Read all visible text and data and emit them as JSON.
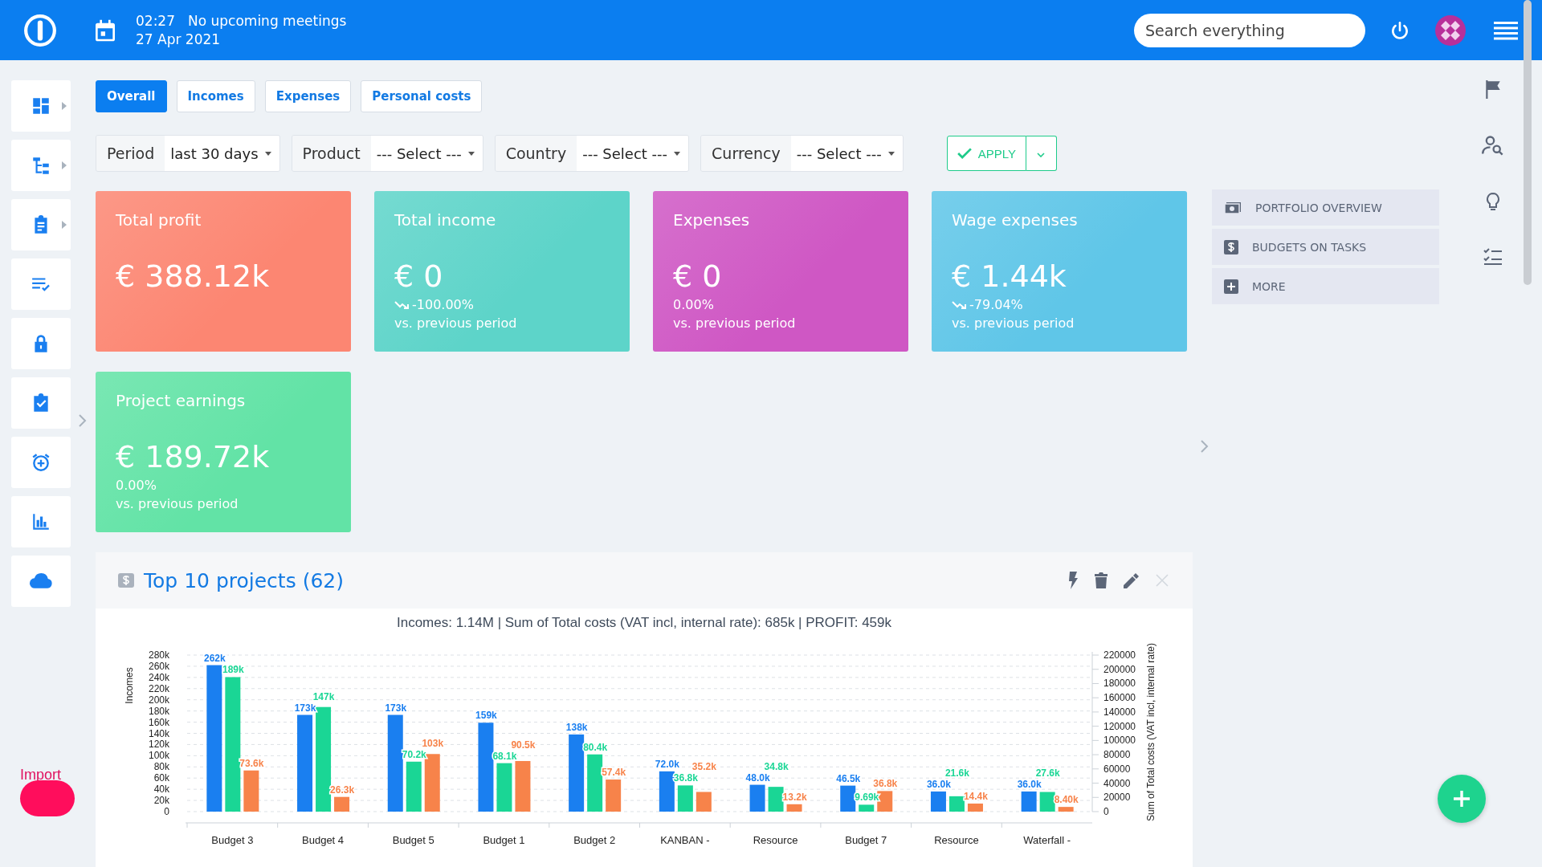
{
  "header": {
    "time": "02:27",
    "meetings": "No upcoming meetings",
    "date": "27 Apr 2021",
    "search": {
      "placeholder": "Search everything"
    }
  },
  "sidebar_items": [
    {
      "has_submenu": true
    },
    {
      "has_submenu": true
    },
    {
      "has_submenu": true
    },
    {
      "has_submenu": false
    },
    {
      "has_submenu": false
    },
    {
      "has_submenu": false
    },
    {
      "has_submenu": false
    },
    {
      "has_submenu": false
    },
    {
      "has_submenu": false
    }
  ],
  "import_label": "Import",
  "tabs": [
    {
      "label": "Overall",
      "selected": true
    },
    {
      "label": "Incomes",
      "selected": false
    },
    {
      "label": "Expenses",
      "selected": false
    },
    {
      "label": "Personal costs",
      "selected": false
    }
  ],
  "filters": [
    {
      "label": "Period",
      "value": "last 30 days"
    },
    {
      "label": "Product",
      "value": "--- Select ---"
    },
    {
      "label": "Country",
      "value": "--- Select ---"
    },
    {
      "label": "Currency",
      "value": "--- Select ---"
    }
  ],
  "apply_button": "APPLY",
  "cards": [
    {
      "title": "Total profit",
      "value": "€ 388.12k",
      "color": "#fc8672"
    },
    {
      "title": "Total income",
      "value": "€ 0",
      "change": "-100.00%",
      "falling": true,
      "note": "vs. previous period",
      "color": "#5dd4c9"
    },
    {
      "title": "Expenses",
      "value": "€ 0",
      "change": "0.00%",
      "falling": false,
      "note": "vs. previous period",
      "color": "#cf57c4"
    },
    {
      "title": "Wage expenses",
      "value": "€ 1.44k",
      "change": "-79.04%",
      "falling": true,
      "note": "vs. previous period",
      "color": "#5fc6e8"
    },
    {
      "title": "Project earnings",
      "value": "€ 189.72k",
      "change": "0.00%",
      "falling": false,
      "note": "vs. previous period",
      "color": "#62e3a6"
    }
  ],
  "quick_links": [
    {
      "label": "PORTFOLIO OVERVIEW",
      "kind": "money"
    },
    {
      "label": "BUDGETS ON TASKS",
      "kind": "dollar"
    },
    {
      "label": "MORE",
      "kind": "plus"
    }
  ],
  "panel": {
    "title": "Top 10 projects (62)",
    "summary": "Incomes: 1.14M | Sum of Total costs (VAT incl, internal rate): 685k | PROFIT: 459k",
    "chart_data": {
      "type": "bar",
      "stacked": false,
      "grid": true,
      "ylabel": "Incomes",
      "y2label": "Sum of Total costs (VAT incl, internal rate)",
      "categories": [
        "Budget 3",
        "Budget 4",
        "Budget 5",
        "Budget 1",
        "Budget 2",
        "KANBAN -",
        "Resource",
        "Budget 7",
        "Resource",
        "Waterfall -"
      ],
      "ylim": [
        0,
        280000
      ],
      "y2lim": [
        0,
        220000
      ],
      "yticks": [
        {
          "value": 0,
          "label": "0"
        },
        {
          "value": 20000,
          "label": "20k"
        },
        {
          "value": 40000,
          "label": "40k"
        },
        {
          "value": 60000,
          "label": "60k"
        },
        {
          "value": 80000,
          "label": "80k"
        },
        {
          "value": 100000,
          "label": "100k"
        },
        {
          "value": 120000,
          "label": "120k"
        },
        {
          "value": 140000,
          "label": "140k"
        },
        {
          "value": 160000,
          "label": "160k"
        },
        {
          "value": 180000,
          "label": "180k"
        },
        {
          "value": 200000,
          "label": "200k"
        },
        {
          "value": 220000,
          "label": "220k"
        },
        {
          "value": 240000,
          "label": "240k"
        },
        {
          "value": 260000,
          "label": "260k"
        },
        {
          "value": 280000,
          "label": "280k"
        }
      ],
      "y2ticks": [
        0,
        20000,
        40000,
        60000,
        80000,
        100000,
        120000,
        140000,
        160000,
        180000,
        200000,
        220000
      ],
      "series": [
        {
          "color": "#1a7ff0",
          "values": [
            262000,
            173000,
            173000,
            159000,
            138000,
            72000,
            48000,
            46500,
            36000,
            36000
          ],
          "value_labels": [
            "262k",
            "173k",
            "173k",
            "159k",
            "138k",
            "72.0k",
            "48.0k",
            "46.5k",
            "36.0k",
            "36.0k"
          ]
        },
        {
          "color": "#1ad695",
          "axis": "y2",
          "values": [
            189000,
            147000,
            70200,
            68100,
            80400,
            36800,
            34800,
            9690,
            21600,
            27600
          ],
          "value_labels": [
            "189k",
            "147k",
            "70.2k",
            "68.1k",
            "80.4k",
            "36.8k",
            "34.8k",
            "9.69k",
            "21.6k",
            "27.6k"
          ]
        },
        {
          "color": "#f7834a",
          "values": [
            73600,
            26300,
            103000,
            90500,
            57400,
            35200,
            13200,
            36800,
            14400,
            8400
          ],
          "value_labels": [
            "73.6k",
            "26.3k",
            "103k",
            "90.5k",
            "57.4k",
            "35.2k",
            "13.2k",
            "36.8k",
            "14.4k",
            "8.40k"
          ]
        }
      ]
    }
  }
}
